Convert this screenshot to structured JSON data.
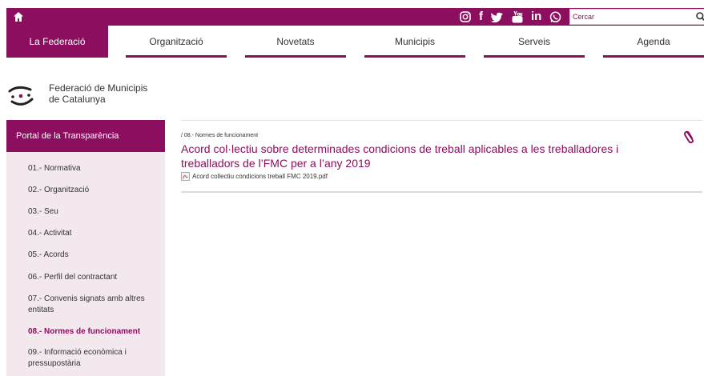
{
  "topbar": {
    "home_icon": "home-icon",
    "socials": [
      "instagram-icon",
      "facebook-icon",
      "twitter-icon",
      "youtube-icon",
      "linkedin-icon",
      "whatsapp-icon"
    ],
    "facebook_glyph": "f",
    "linkedin_glyph": "in",
    "search_placeholder": "Cercar"
  },
  "nav": {
    "items": [
      {
        "label": "La Federació"
      },
      {
        "label": "Organització"
      },
      {
        "label": "Novetats"
      },
      {
        "label": "Municipis"
      },
      {
        "label": "Serveis"
      },
      {
        "label": "Agenda"
      }
    ]
  },
  "brand": {
    "line1": "Federació de Municipis",
    "line2": "de Catalunya"
  },
  "sidebar": {
    "header": "Portal de la Transparència",
    "items": [
      {
        "label": "01.- Normativa"
      },
      {
        "label": "02.- Organització"
      },
      {
        "label": "03.- Seu"
      },
      {
        "label": "04.- Activitat"
      },
      {
        "label": "05.- Acords"
      },
      {
        "label": "06.- Perfil del contractant"
      },
      {
        "label": "07.- Convenis signats amb altres entitats"
      },
      {
        "label": "08.- Normes de funcionament"
      },
      {
        "label": "09.- Informació econòmica i pressupostària"
      }
    ]
  },
  "content": {
    "breadcrumb": "/ 08.- Normes de funcionament",
    "title": "Acord col·lectiu sobre determinades condicions de treball aplicables a les treballadores i treballadors de l’FMC per a l’any 2019",
    "attachment": "Acord collectiu condicions treball FMC 2019.pdf"
  },
  "colors": {
    "brand": "#8b0f5e",
    "sidebar_bg": "#f2e8ee"
  }
}
